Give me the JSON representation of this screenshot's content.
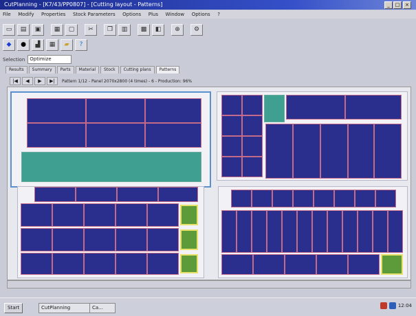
{
  "window": {
    "title": "CutPlanning - [K7/43/PP0807] - [Cutting layout - Patterns]",
    "min": "_",
    "max": "□",
    "close": "×"
  },
  "menu": [
    "File",
    "Modify",
    "Properties",
    "Stock Parameters",
    "Options",
    "Plus",
    "Window",
    "Options",
    "?"
  ],
  "status": {
    "label": "Selection",
    "value": "Optimize"
  },
  "tabs": [
    "Results",
    "Summary",
    "Parts",
    "Material",
    "Stock",
    "Cutting plans",
    "Patterns"
  ],
  "active_tab": 6,
  "nav": {
    "buttons": [
      "|◀",
      "◀",
      "▶",
      "▶|"
    ],
    "text": "Pattern 1/12 - Panel 2070x2800 (4 times) - 6 - Production: 96%"
  },
  "taskbar": {
    "start": "Start",
    "task1": "CutPlanning",
    "task2": "Ca...",
    "clock": "12:04"
  },
  "colors": {
    "panel_cell": "#2a2f8e",
    "offcut": "#3f9f90",
    "marked": "#5c9a3a",
    "cut_line": "#c46b8a"
  }
}
